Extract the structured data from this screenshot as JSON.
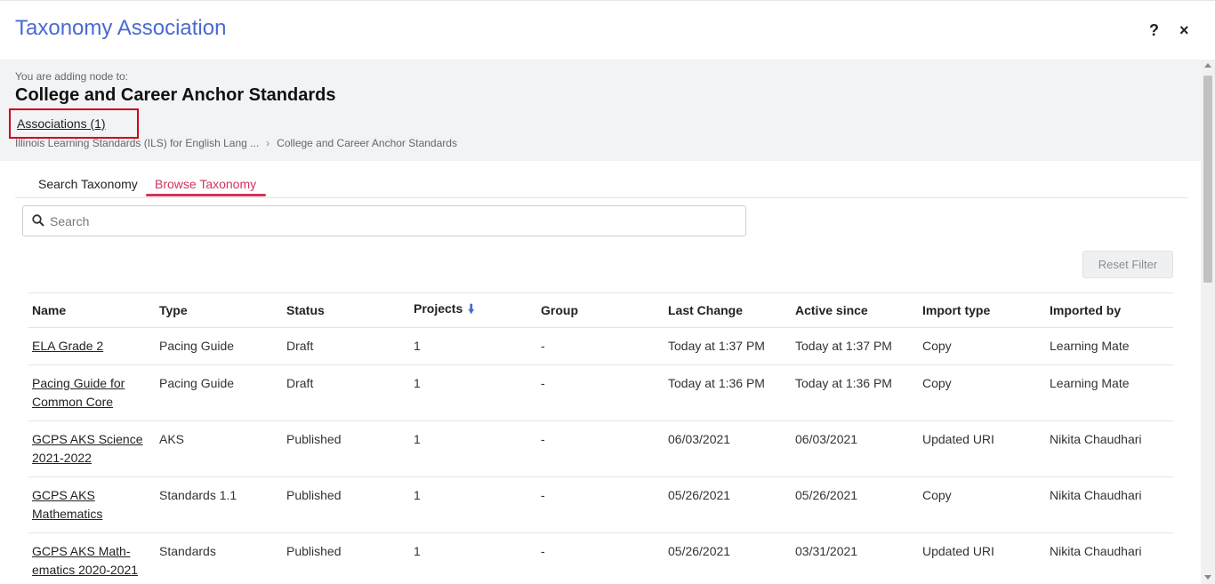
{
  "dialog": {
    "title": "Taxonomy Association",
    "help_label": "?",
    "close_label": "×"
  },
  "context": {
    "adding_label": "You are adding node to:",
    "node_title": "College and Career Anchor Standards",
    "associations_link": "Associations (1)",
    "breadcrumb": [
      "Illinois Learning Standards (ILS) for English Lang ...",
      "College and Career Anchor Standards"
    ],
    "breadcrumb_separator": "›"
  },
  "tabs": [
    {
      "label": "Search Taxonomy",
      "active": false
    },
    {
      "label": "Browse Taxonomy",
      "active": true
    }
  ],
  "search": {
    "placeholder": "Search",
    "value": ""
  },
  "reset_filter_label": "Reset Filter",
  "table": {
    "columns": [
      "Name",
      "Type",
      "Status",
      "Projects",
      "Group",
      "Last Change",
      "Active since",
      "Import type",
      "Imported by"
    ],
    "sort_column": "Projects",
    "sort_icon": "arrow-down",
    "rows": [
      [
        "ELA Grade 2",
        "Pacing Guide",
        "Draft",
        "1",
        "-",
        "Today at 1:37 PM",
        "Today at 1:37 PM",
        "Copy",
        "Learning Mate"
      ],
      [
        "Pacing Guide for Common Core",
        "Pacing Guide",
        "Draft",
        "1",
        "-",
        "Today at 1:36 PM",
        "Today at 1:36 PM",
        "Copy",
        "Learning Mate"
      ],
      [
        "GCPS AKS Science 2021-2022",
        "AKS",
        "Published",
        "1",
        "-",
        "06/03/2021",
        "06/03/2021",
        "Updated URI",
        "Nikita Chaudhari"
      ],
      [
        "GCPS AKS Mathematics",
        "Standards 1.1",
        "Published",
        "1",
        "-",
        "05/26/2021",
        "05/26/2021",
        "Copy",
        "Nikita Chaudhari"
      ],
      [
        "GCPS AKS Math-ematics 2020-2021",
        "Standards",
        "Published",
        "1",
        "-",
        "05/26/2021",
        "03/31/2021",
        "Updated URI",
        "Nikita Chaudhari"
      ]
    ]
  },
  "colors": {
    "title_blue": "#4a6ad1",
    "active_tab": "#d2335d",
    "highlight_box": "#d0021b"
  }
}
